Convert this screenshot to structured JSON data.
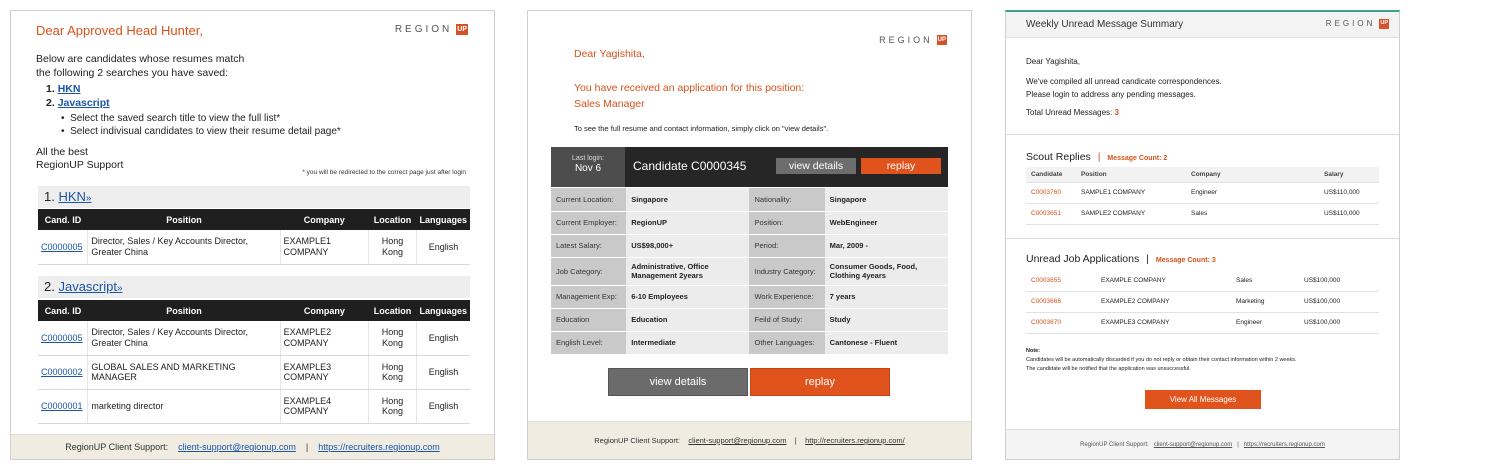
{
  "email1": {
    "greeting": "Dear Approved Head Hunter,",
    "logo_text": "REGION",
    "logo_mark": "UP",
    "intro_line1": "Below are candidates whose resumes match",
    "intro_line2": "the following 2 searches you have saved:",
    "searches": [
      {
        "num": "1.",
        "label": "HKN"
      },
      {
        "num": "2.",
        "label": "Javascript"
      }
    ],
    "bullets": [
      "Select the saved search title to view the full list*",
      "Select indivisual candidates to view their resume detail page*"
    ],
    "signoff1": "All the best",
    "signoff2": "RegionUP Support",
    "redirect_note": "* you will be redirected to the correct page just after login",
    "columns": [
      "Cand. ID",
      "Position",
      "Company",
      "Location",
      "Languages"
    ],
    "sections": [
      {
        "num": "1.",
        "title": "HKN",
        "arrow": "»",
        "rows": [
          {
            "id": "C0000005",
            "position": "Director, Sales / Key Accounts Director, Greater China",
            "company": "EXAMPLE1 COMPANY",
            "location": "Hong Kong",
            "language": "English"
          }
        ]
      },
      {
        "num": "2.",
        "title": "Javascript",
        "arrow": "»",
        "rows": [
          {
            "id": "C0000005",
            "position": "Director, Sales / Key Accounts Director, Greater China",
            "company": "EXAMPLE2 COMPANY",
            "location": "Hong Kong",
            "language": "English"
          },
          {
            "id": "C0000002",
            "position": "GLOBAL SALES AND MARKETING MANAGER",
            "company": "EXAMPLE3 COMPANY",
            "location": "Hong Kong",
            "language": "English"
          },
          {
            "id": "C0000001",
            "position": "marketing director",
            "company": "EXAMPLE4 COMPANY",
            "location": "Hong Kong",
            "language": "English"
          }
        ]
      }
    ],
    "footer_label": "RegionUP Client Support:",
    "footer_email": "client-support@regionup.com",
    "footer_sep": "|",
    "footer_url": "https://recruiters.regionup.com"
  },
  "email2": {
    "logo_text": "REGION",
    "logo_mark": "UP",
    "greeting": "Dear Yagishita,",
    "headline": "You have received an application for this position:",
    "position": "Sales Manager",
    "instruction": "To see the full resume and contact information, simply click on \"view details\".",
    "last_login_label": "Last login:",
    "last_login_value": "Nov 6",
    "candidate_title": "Candidate C0000345",
    "view_details": "view details",
    "replay": "replay",
    "details": [
      [
        "Current Location:",
        "Singapore",
        "Nationality:",
        "Singapore"
      ],
      [
        "Current Employer:",
        "RegionUP",
        "Position:",
        "WebEngineer"
      ],
      [
        "Latest Salary:",
        "US$98,000+",
        "Period:",
        "Mar, 2009 -"
      ],
      [
        "Job Category:",
        "Administrative, Office Management 2years",
        "Industry Category:",
        "Consumer Goods, Food, Clothing 4years"
      ],
      [
        "Management Exp:",
        "6-10 Employees",
        "Work Experience:",
        "7   years"
      ],
      [
        "Education",
        "Education",
        "Feild of Study:",
        "Study"
      ],
      [
        "English Level:",
        "Intermediate",
        "Other Languages:",
        "Cantonese - Fluent"
      ]
    ],
    "footer_label": "RegionUP Client Support:",
    "footer_email": "client-support@regionup.com",
    "footer_sep": "|",
    "footer_url": "http://recruiters.regionup.com/"
  },
  "email3": {
    "title": "Weekly Unread Message Summary",
    "logo_text": "REGION",
    "logo_mark": "UP",
    "greeting": "Dear Yagishita,",
    "line1": "We've compiled all unread candicate correspondences.",
    "line2": "Please login to address any pending messages.",
    "total_label": "Total Unread Messages:",
    "total_value": "3",
    "scout_title": "Scout Replies",
    "scout_count": "Message Count: 2",
    "scout_columns": [
      "Candidate",
      "Position",
      "Company",
      "Salary"
    ],
    "scout_rows": [
      [
        "C0003760",
        "SAMPLE1 COMPANY",
        "Engineer",
        "US$110,000"
      ],
      [
        "C0003651",
        "SAMPLE2 COMPANY",
        "Sales",
        "US$110,000"
      ]
    ],
    "apps_title": "Unread Job Applications",
    "apps_count": "Message Count: 3",
    "apps_rows": [
      [
        "C0003655",
        "EXAMPLE COMPANY",
        "Sales",
        "US$100,000"
      ],
      [
        "C0003666",
        "EXAMPLE2 COMPANY",
        "Marketing",
        "US$100,000"
      ],
      [
        "C0003670",
        "EXAMPLE3 COMPANY",
        "Engineer",
        "US$100,000"
      ]
    ],
    "note_title": "Note:",
    "note_line1": "Candidates will be automatically discarded if you do not reply or obtain their contact information within 2 weeks.",
    "note_line2": "The candidate will be notified that the application was unsuccessful.",
    "view_all": "View All Messages",
    "footer_label": "RegionUP Client Support:",
    "footer_email": "client-support@regionup.com",
    "footer_sep": "|",
    "footer_url": "https://recruiters.regionup.com"
  },
  "colors": {
    "accent": "#d5531b",
    "link": "#1a56a8",
    "dark_header": "#1f1f1f",
    "footer_bg": "#f0ece2",
    "button_gray": "#6b6b6b",
    "button_orange": "#e0531c"
  }
}
